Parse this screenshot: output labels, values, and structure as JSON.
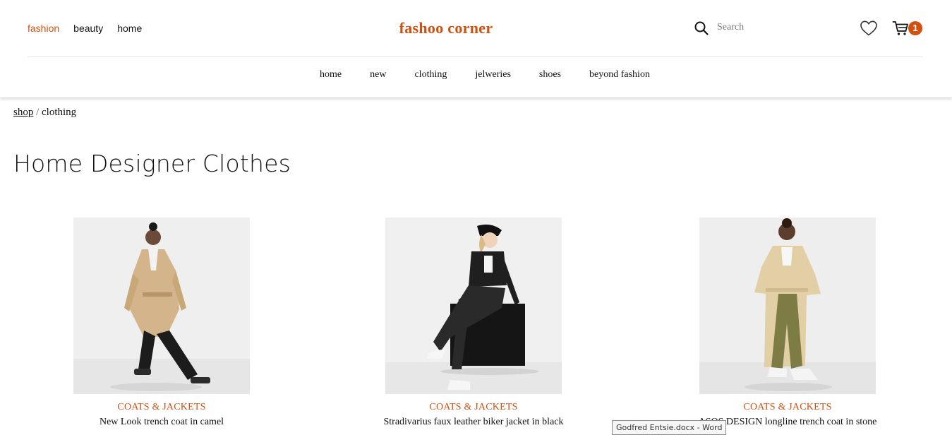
{
  "header": {
    "categories": [
      {
        "label": "fashion",
        "active": true
      },
      {
        "label": "beauty",
        "active": false
      },
      {
        "label": "home",
        "active": false
      }
    ],
    "logo": "fashoo corner",
    "search": {
      "placeholder": "Search",
      "value": ""
    },
    "cart_count": "1",
    "icons": {
      "search": "search-icon",
      "wishlist": "heart-icon",
      "cart": "cart-icon"
    }
  },
  "main_nav": [
    "home",
    "new",
    "clothing",
    "jelweries",
    "shoes",
    "beyond fashion"
  ],
  "breadcrumb": {
    "link": "shop",
    "separator": "/",
    "current": "clothing"
  },
  "page_title": "Home Designer Clothes",
  "products": [
    {
      "category": "COATS & JACKETS",
      "name": "New Look trench coat in camel",
      "price": ""
    },
    {
      "category": "COATS & JACKETS",
      "name": "Stradivarius faux leather biker jacket in black",
      "price": ""
    },
    {
      "category": "COATS & JACKETS",
      "name": "ASOS DESIGN longline trench coat in stone",
      "price": ""
    }
  ],
  "taskbar_tooltip": "Godfred Entsie.docx - Word",
  "colors": {
    "accent": "#d2500f",
    "text": "#111111",
    "background": "#ffffff"
  }
}
